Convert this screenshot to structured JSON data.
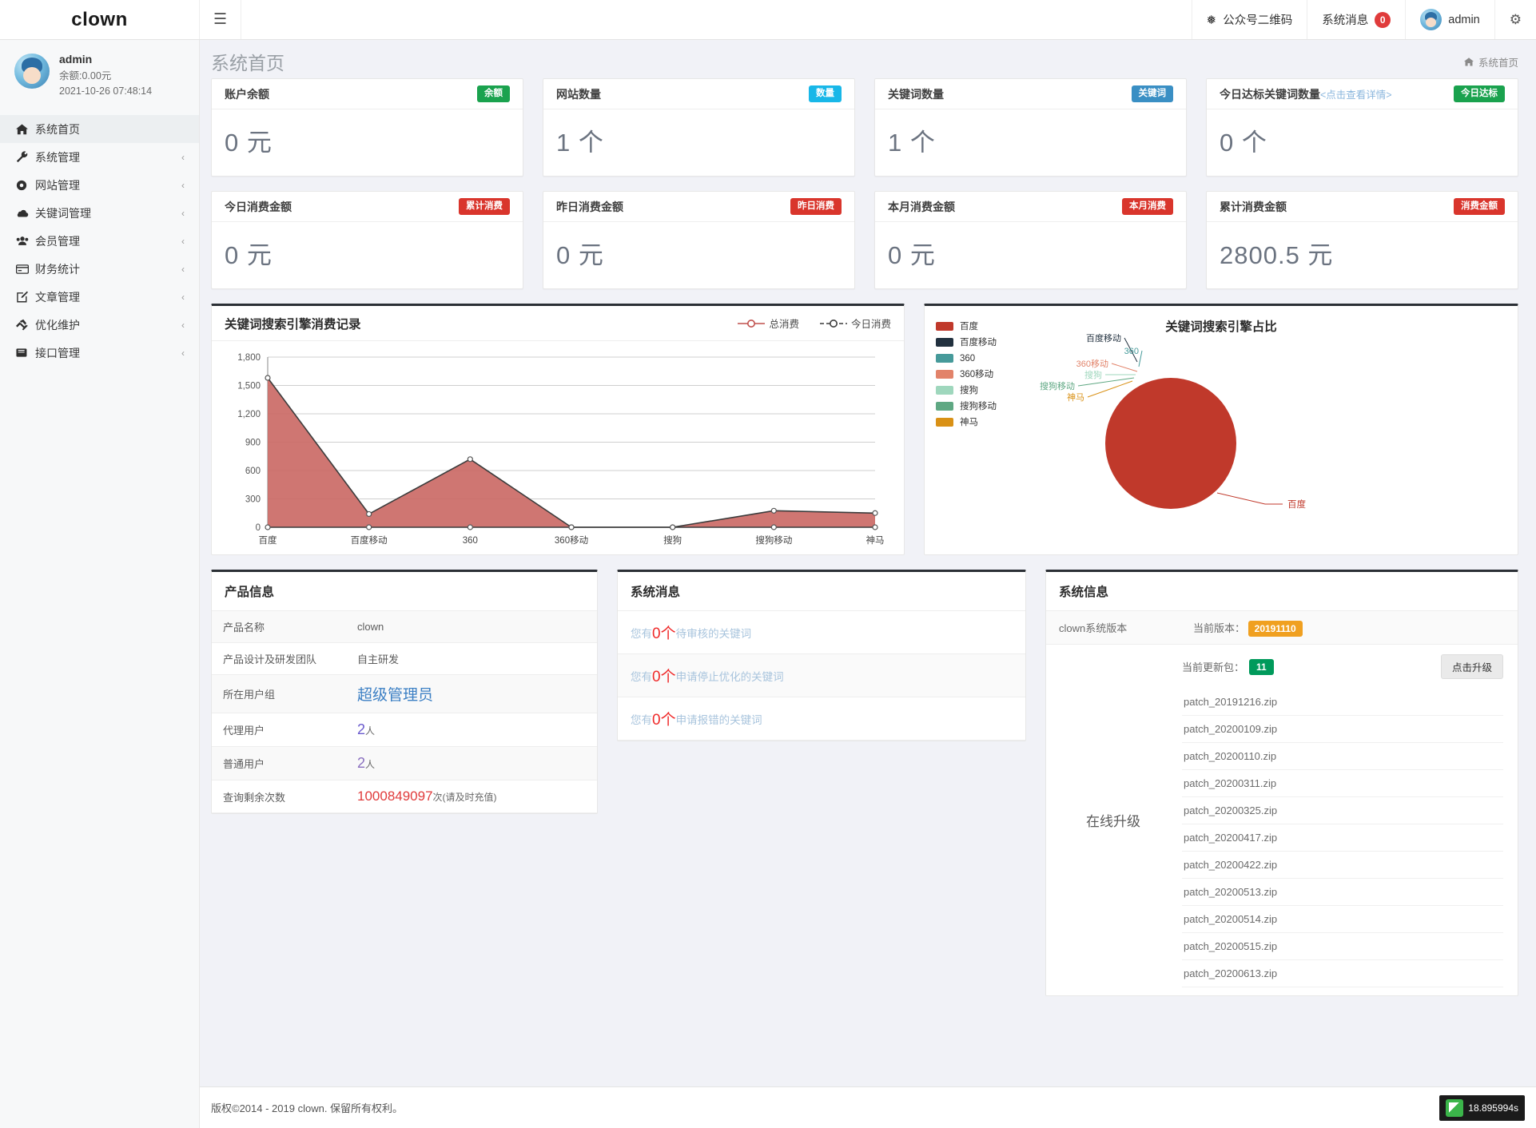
{
  "topbar": {
    "brand": "clown",
    "menu_icon": "hamburger-icon",
    "items": [
      {
        "label": "公众号二维码",
        "icon": "wechat-icon"
      },
      {
        "label": "系统消息",
        "badge": "0"
      },
      {
        "label": "admin",
        "icon": "avatar-icon"
      },
      {
        "label": "",
        "icon": "gear-icon"
      }
    ]
  },
  "sidebar": {
    "profile": {
      "name": "admin",
      "balance": "余额:0.00元",
      "time": "2021-10-26 07:48:14"
    },
    "items": [
      {
        "label": "系统首页",
        "icon": "home-icon",
        "caret": "",
        "active": true
      },
      {
        "label": "系统管理",
        "icon": "wrench-icon",
        "caret": "‹"
      },
      {
        "label": "网站管理",
        "icon": "circle-dot-icon",
        "caret": "‹"
      },
      {
        "label": "关键词管理",
        "icon": "cloud-icon",
        "caret": "‹"
      },
      {
        "label": "会员管理",
        "icon": "users-icon",
        "caret": "‹"
      },
      {
        "label": "财务统计",
        "icon": "card-icon",
        "caret": "‹"
      },
      {
        "label": "文章管理",
        "icon": "edit-icon",
        "caret": "‹"
      },
      {
        "label": "优化维护",
        "icon": "hammer-icon",
        "caret": "‹"
      },
      {
        "label": "接口管理",
        "icon": "book-icon",
        "caret": "‹"
      }
    ]
  },
  "page": {
    "title": "系统首页",
    "breadcrumb_home_icon": "home-icon",
    "breadcrumb": "系统首页"
  },
  "stats_row1": [
    {
      "title": "账户余额",
      "pill": "余额",
      "pill_color": "#1aa24e",
      "value": "0 元"
    },
    {
      "title": "网站数量",
      "pill": "数量",
      "pill_color": "#18b7e8",
      "value": "1 个"
    },
    {
      "title": "关键词数量",
      "pill": "关键词",
      "pill_color": "#3a8fc4",
      "value": "1 个"
    },
    {
      "title": "今日达标关键词数量",
      "title_link": "<点击查看详情>",
      "pill": "今日达标",
      "pill_color": "#1aa24e",
      "value": "0 个"
    }
  ],
  "stats_row2": [
    {
      "title": "今日消费金额",
      "pill": "累计消费",
      "pill_color": "#d9352c",
      "value": "0 元"
    },
    {
      "title": "昨日消费金额",
      "pill": "昨日消费",
      "pill_color": "#d9352c",
      "value": "0 元"
    },
    {
      "title": "本月消费金额",
      "pill": "本月消费",
      "pill_color": "#d9352c",
      "value": "0 元"
    },
    {
      "title": "累计消费金额",
      "pill": "消费金额",
      "pill_color": "#d9352c",
      "value": "2800.5 元"
    }
  ],
  "chart_data": [
    {
      "id": "line",
      "type": "area",
      "title": "关键词搜索引擎消费记录",
      "categories": [
        "百度",
        "百度移动",
        "360",
        "360移动",
        "搜狗",
        "搜狗移动",
        "神马"
      ],
      "series": [
        {
          "name": "总消费",
          "values": [
            1580,
            140,
            720,
            0,
            0,
            175,
            150
          ],
          "color": "#c0504d"
        },
        {
          "name": "今日消费",
          "values": [
            0,
            0,
            0,
            0,
            0,
            0,
            0
          ],
          "color": "#3c3c3c"
        }
      ],
      "legend": [
        "总消费",
        "今日消费"
      ],
      "legend_position": "top-right",
      "ylabel": "",
      "xlabel": "",
      "ylim": [
        0,
        1800
      ],
      "yticks": [
        "0",
        "300",
        "600",
        "900",
        "1,200",
        "1,500",
        "1,800"
      ],
      "grid": true
    },
    {
      "id": "pie",
      "type": "pie",
      "title": "关键词搜索引擎占比",
      "labels": [
        "百度",
        "百度移动",
        "360",
        "360移动",
        "搜狗",
        "搜狗移动",
        "神马"
      ],
      "values": [
        100,
        0,
        0,
        0,
        0,
        0,
        0
      ],
      "colors": [
        "#c0392b",
        "#22313f",
        "#469a9a",
        "#e2836a",
        "#9fd7bd",
        "#5fa883",
        "#d99116"
      ],
      "legend_position": "left",
      "callout_labels": [
        "百度移动",
        "360",
        "360移动",
        "搜狗",
        "搜狗移动",
        "神马",
        "百度"
      ]
    }
  ],
  "product_info": {
    "title": "产品信息",
    "rows": [
      {
        "k": "产品名称",
        "v": "clown",
        "style": "plain"
      },
      {
        "k": "产品设计及研发团队",
        "v": "自主研发",
        "style": "plain"
      },
      {
        "k": "所在用户组",
        "v": "超级管理员",
        "style": "blue"
      },
      {
        "k": "代理用户",
        "v": "2",
        "suffix": "人",
        "style": "purple"
      },
      {
        "k": "普通用户",
        "v": "2",
        "suffix": "人",
        "style": "violet"
      },
      {
        "k": "查询剩余次数",
        "v": "1000849097",
        "suffix": "次(请及时充值)",
        "style": "red"
      }
    ]
  },
  "system_messages": {
    "title": "系统消息",
    "rows": [
      {
        "pre": "您有",
        "num": "0",
        "mid": "个",
        "post": "待审核的关键词"
      },
      {
        "pre": "您有",
        "num": "0",
        "mid": "个",
        "post": "申请停止优化的关键词"
      },
      {
        "pre": "您有",
        "num": "0",
        "mid": "个",
        "post": "申请报错的关键词"
      }
    ]
  },
  "system_info": {
    "title": "系统信息",
    "version_label": "clown系统版本",
    "current_version_label": "当前版本：",
    "current_version": "20191110",
    "upgrade_label": "在线升级",
    "package_label": "当前更新包：",
    "package_count": "11",
    "upgrade_button": "点击升级",
    "patches": [
      "patch_20191216.zip",
      "patch_20200109.zip",
      "patch_20200110.zip",
      "patch_20200311.zip",
      "patch_20200325.zip",
      "patch_20200417.zip",
      "patch_20200422.zip",
      "patch_20200513.zip",
      "patch_20200514.zip",
      "patch_20200515.zip",
      "patch_20200613.zip"
    ]
  },
  "footer": {
    "copyright": "版权©2014 - 2019 clown. 保留所有权利。",
    "perf": "18.895994s"
  }
}
